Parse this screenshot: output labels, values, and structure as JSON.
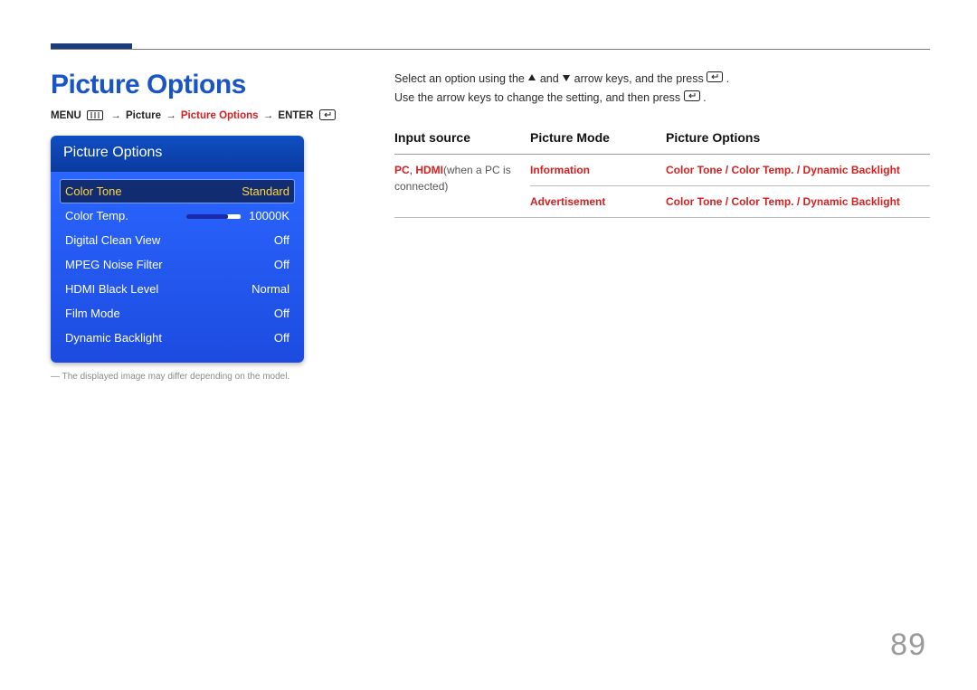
{
  "title": "Picture Options",
  "breadcrumb": {
    "menu": "MENU",
    "seg1": "Picture",
    "seg2": "Picture Options",
    "enter": "ENTER"
  },
  "osd": {
    "title": "Picture Options",
    "rows": [
      {
        "label": "Color Tone",
        "value": "Standard",
        "selected": true
      },
      {
        "label": "Color Temp.",
        "value": "10000K",
        "slider": true
      },
      {
        "label": "Digital Clean View",
        "value": "Off"
      },
      {
        "label": "MPEG Noise Filter",
        "value": "Off"
      },
      {
        "label": "HDMI Black Level",
        "value": "Normal"
      },
      {
        "label": "Film Mode",
        "value": "Off"
      },
      {
        "label": "Dynamic Backlight",
        "value": "Off"
      }
    ]
  },
  "footnote": "― The displayed image may differ depending on the model.",
  "instructions": {
    "line1_pre": "Select an option using the ",
    "line1_mid": " and ",
    "line1_post": " arrow keys, and the press ",
    "line1_end": ".",
    "line2_pre": "Use the arrow keys to change the setting, and then press ",
    "line2_end": "."
  },
  "table": {
    "headers": [
      "Input source",
      "Picture Mode",
      "Picture Options"
    ],
    "rows": [
      {
        "src_red": "PC",
        "src_sep": ", ",
        "src_red2": "HDMI",
        "src_note": "(when a PC is connected)",
        "mode": "Information",
        "opts": "Color Tone / Color Temp. / Dynamic Backlight"
      },
      {
        "mode": "Advertisement",
        "opts": "Color Tone / Color Temp. / Dynamic Backlight"
      }
    ]
  },
  "page_number": "89"
}
